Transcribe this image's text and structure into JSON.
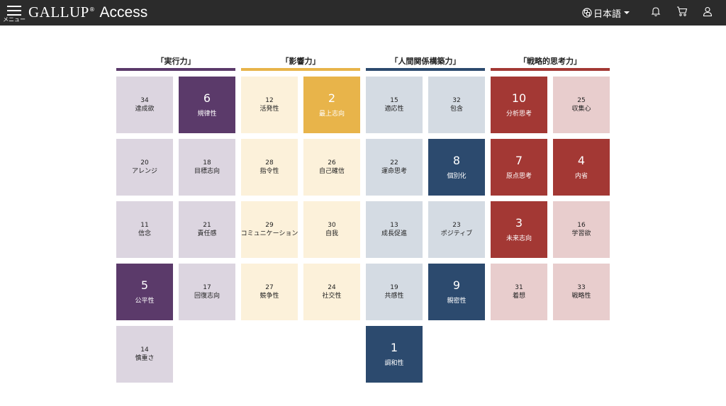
{
  "header": {
    "menu_label": "メニュー",
    "brand": "GALLUP",
    "registered": "®",
    "app_name": "Access",
    "language": "日本語"
  },
  "domains": [
    {
      "title": "「実行力」",
      "color": "#5b3a6a",
      "light": "#dcd5e0",
      "strengths": [
        {
          "rank": "34",
          "name": "達成欲",
          "top": false
        },
        {
          "rank": "6",
          "name": "規律性",
          "top": true
        },
        {
          "rank": "20",
          "name": "アレンジ",
          "top": false
        },
        {
          "rank": "18",
          "name": "目標志向",
          "top": false
        },
        {
          "rank": "11",
          "name": "信念",
          "top": false
        },
        {
          "rank": "21",
          "name": "責任感",
          "top": false
        },
        {
          "rank": "5",
          "name": "公平性",
          "top": true
        },
        {
          "rank": "17",
          "name": "回復志向",
          "top": false
        },
        {
          "rank": "14",
          "name": "慎重さ",
          "top": false
        }
      ]
    },
    {
      "title": "「影響力」",
      "color": "#e8b44a",
      "light": "#fcf1da",
      "strengths": [
        {
          "rank": "12",
          "name": "活発性",
          "top": false
        },
        {
          "rank": "2",
          "name": "最上志向",
          "top": true
        },
        {
          "rank": "28",
          "name": "指令性",
          "top": false
        },
        {
          "rank": "26",
          "name": "自己確信",
          "top": false
        },
        {
          "rank": "29",
          "name": "コミュニケーション",
          "top": false
        },
        {
          "rank": "30",
          "name": "自我",
          "top": false
        },
        {
          "rank": "27",
          "name": "競争性",
          "top": false
        },
        {
          "rank": "24",
          "name": "社交性",
          "top": false
        }
      ]
    },
    {
      "title": "「人間関係構築力」",
      "color": "#2c4a6e",
      "light": "#d4dbe3",
      "strengths": [
        {
          "rank": "15",
          "name": "適応性",
          "top": false
        },
        {
          "rank": "32",
          "name": "包含",
          "top": false
        },
        {
          "rank": "22",
          "name": "運命思考",
          "top": false
        },
        {
          "rank": "8",
          "name": "個別化",
          "top": true
        },
        {
          "rank": "13",
          "name": "成長促進",
          "top": false
        },
        {
          "rank": "23",
          "name": "ポジティブ",
          "top": false
        },
        {
          "rank": "19",
          "name": "共感性",
          "top": false
        },
        {
          "rank": "9",
          "name": "親密性",
          "top": true
        },
        {
          "rank": "1",
          "name": "調和性",
          "top": true
        }
      ]
    },
    {
      "title": "「戦略的思考力」",
      "color": "#a33834",
      "light": "#e8cdcd",
      "strengths": [
        {
          "rank": "10",
          "name": "分析思考",
          "top": true
        },
        {
          "rank": "25",
          "name": "収集心",
          "top": false
        },
        {
          "rank": "7",
          "name": "原点思考",
          "top": true
        },
        {
          "rank": "4",
          "name": "内省",
          "top": true
        },
        {
          "rank": "3",
          "name": "未来志向",
          "top": true
        },
        {
          "rank": "16",
          "name": "学習欲",
          "top": false
        },
        {
          "rank": "31",
          "name": "着想",
          "top": false
        },
        {
          "rank": "33",
          "name": "戦略性",
          "top": false
        }
      ]
    }
  ]
}
